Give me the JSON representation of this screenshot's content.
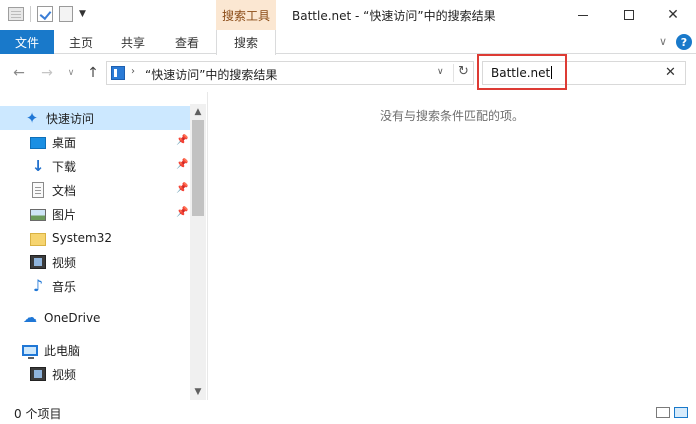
{
  "window": {
    "title": "Battle.net - “快速访问”中的搜索结果",
    "context_tab_title": "搜索工具"
  },
  "ribbon": {
    "tabs": [
      "文件",
      "主页",
      "共享",
      "查看",
      "搜索"
    ],
    "help": "?"
  },
  "address_bar": {
    "path": "“快速访问”中的搜索结果"
  },
  "search": {
    "value": "Battle.net"
  },
  "nav_pane": {
    "items": [
      {
        "label": "快速访问",
        "icon": "star-icon"
      },
      {
        "label": "桌面",
        "icon": "desktop-icon"
      },
      {
        "label": "下载",
        "icon": "download-icon"
      },
      {
        "label": "文档",
        "icon": "document-icon"
      },
      {
        "label": "图片",
        "icon": "picture-icon"
      },
      {
        "label": "System32",
        "icon": "folder-icon"
      },
      {
        "label": "视频",
        "icon": "video-icon"
      },
      {
        "label": "音乐",
        "icon": "music-icon"
      },
      {
        "label": "OneDrive",
        "icon": "cloud-icon"
      },
      {
        "label": "此电脑",
        "icon": "computer-icon"
      },
      {
        "label": "视频",
        "icon": "video-icon"
      }
    ]
  },
  "content": {
    "empty_message": "没有与搜索条件匹配的项。"
  },
  "status_bar": {
    "item_count": "0 个项目"
  },
  "colors": {
    "accent": "#1979ca",
    "context_tab": "#fbe7d2",
    "selection": "#cce8ff",
    "highlight_box": "#dd3b34"
  }
}
